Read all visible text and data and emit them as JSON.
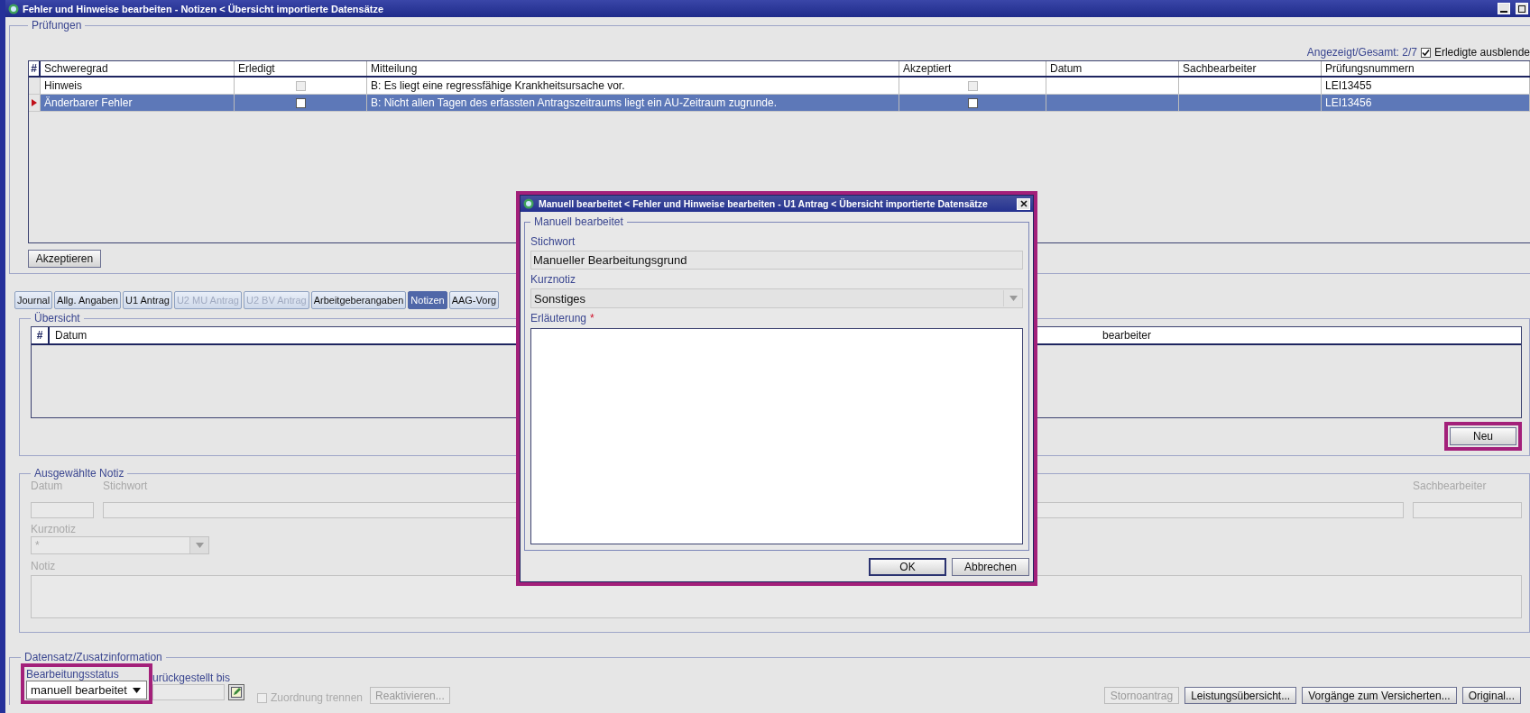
{
  "window": {
    "title": "Fehler und Hinweise  bearbeiten - Notizen < Übersicht importierte Datensätze"
  },
  "pruefungen": {
    "legend": "Prüfungen",
    "count_label": "Angezeigt/Gesamt: 2/7",
    "hide_done": {
      "label": "Erledigte ausblende",
      "checked": true
    },
    "table": {
      "columns": [
        "#",
        "Schweregrad",
        "Erledigt",
        "Mitteilung",
        "Akzeptiert",
        "Datum",
        "Sachbearbeiter",
        "Prüfungsnummern"
      ],
      "rows": [
        {
          "schweregrad": "Hinweis",
          "erledigt": false,
          "mitteilung": "B: Es liegt eine regressfähige Krankheitsursache vor.",
          "akzeptiert": false,
          "pruefungsnummer": "LEI13455",
          "selected": false
        },
        {
          "schweregrad": "Änderbarer Fehler",
          "erledigt": false,
          "mitteilung": "B: Nicht allen Tagen des erfassten Antragszeitraums liegt ein AU-Zeitraum zugrunde.",
          "akzeptiert": false,
          "pruefungsnummer": "LEI13456",
          "selected": true
        }
      ]
    },
    "accept_button": "Akzeptieren"
  },
  "tabs": [
    {
      "label": "Journal",
      "selected": false,
      "disabled": false
    },
    {
      "label": "Allg. Angaben",
      "selected": false,
      "disabled": false
    },
    {
      "label": "U1 Antrag",
      "selected": false,
      "disabled": false
    },
    {
      "label": "U2 MU Antrag",
      "selected": false,
      "disabled": true
    },
    {
      "label": "U2 BV Antrag",
      "selected": false,
      "disabled": true
    },
    {
      "label": "Arbeitgeberangaben",
      "selected": false,
      "disabled": false
    },
    {
      "label": "Notizen",
      "selected": true,
      "disabled": false
    },
    {
      "label": "AAG-Vorg",
      "selected": false,
      "disabled": false
    }
  ],
  "uebersicht": {
    "legend": "Übersicht",
    "columns": [
      "#",
      "Datum",
      "bearbeiter"
    ],
    "new_button": "Neu"
  },
  "ausgewaehlte_notiz": {
    "legend": "Ausgewählte Notiz",
    "datum_label": "Datum",
    "stichwort_label": "Stichwort",
    "sachbearbeiter_label": "Sachbearbeiter",
    "kurznotiz_label": "Kurznotiz",
    "kurznotiz_value": "*",
    "notiz_label": "Notiz"
  },
  "datensatz": {
    "legend": "Datensatz/Zusatzinformation",
    "status_label": "Bearbeitungsstatus",
    "status_value": "manuell bearbeitet",
    "deferred_label": "urückgestellt bis",
    "unlink": {
      "label": "Zuordnung trennen",
      "checked": false
    },
    "reactivate_button": {
      "label": "Reaktivieren...",
      "disabled": true
    },
    "buttons": [
      {
        "label": "Stornoantrag",
        "disabled": true
      },
      {
        "label": "Leistungsübersicht...",
        "disabled": false
      },
      {
        "label": "Vorgänge zum Versicherten...",
        "disabled": false
      },
      {
        "label": "Original...",
        "disabled": false
      }
    ]
  },
  "dialog": {
    "title": "Manuell bearbeitet < Fehler und Hinweise  bearbeiten - U1 Antrag < Übersicht importierte Datensätze",
    "legend": "Manuell bearbeitet",
    "stichwort_label": "Stichwort",
    "stichwort_value": "Manueller Bearbeitungsgrund",
    "kurznotiz_label": "Kurznotiz",
    "kurznotiz_value": "Sonstiges",
    "erlaeuterung_label": "Erläuterung",
    "required_mark": "*",
    "buttons": [
      "OK",
      "Abbrechen"
    ]
  }
}
